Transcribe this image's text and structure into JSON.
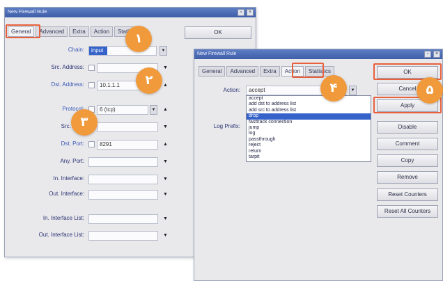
{
  "win1": {
    "title": "New Firewall Rule",
    "tabs": [
      "General",
      "Advanced",
      "Extra",
      "Action",
      "Statistics"
    ],
    "ok_label": "OK",
    "rows": [
      {
        "label": "Chain:",
        "value": "input"
      },
      {
        "label": "Src. Address:",
        "value": ""
      },
      {
        "label": "Dst. Address:",
        "value": "10.1.1.1"
      },
      {
        "label": "Protocol:",
        "value": "6 (tcp)"
      },
      {
        "label": "Src. Port:",
        "value": ""
      },
      {
        "label": "Dst. Port:",
        "value": "8291"
      },
      {
        "label": "Any. Port:",
        "value": ""
      },
      {
        "label": "In. Interface:",
        "value": ""
      },
      {
        "label": "Out. Interface:",
        "value": ""
      },
      {
        "label": "In. Interface List:",
        "value": ""
      },
      {
        "label": "Out. Interface List:",
        "value": ""
      }
    ]
  },
  "win2": {
    "title": "New Firewall Rule",
    "tabs": [
      "General",
      "Advanced",
      "Extra",
      "Action",
      "Statistics"
    ],
    "action_label": "Action:",
    "action_value": "accept",
    "log_prefix_label": "Log Prefix:",
    "actions": [
      "accept",
      "add dst to address list",
      "add src to address list",
      "drop",
      "fasttrack connection",
      "jump",
      "log",
      "passthrough",
      "reject",
      "return",
      "tarpit"
    ],
    "selected_index": 3,
    "buttons": [
      "OK",
      "Cancel",
      "Apply",
      "Disable",
      "Comment",
      "Copy",
      "Remove",
      "Reset Counters",
      "Reset All Counters"
    ]
  },
  "badges": [
    "۱",
    "۲",
    "۳",
    "۴",
    "۵"
  ],
  "colors": {
    "highlight": "#e8603c",
    "badge": "#f09a3c",
    "titlebar": "#3e5ea8",
    "selection": "#3563c9"
  }
}
